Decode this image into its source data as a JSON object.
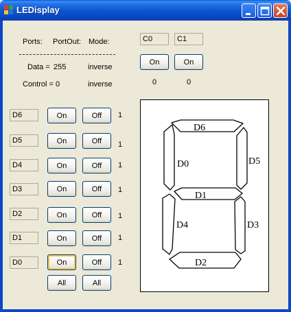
{
  "window": {
    "title": "LEDisplay",
    "icon": "app-icon",
    "controls": [
      "minimize-icon",
      "maximize-icon",
      "close-icon"
    ]
  },
  "header": {
    "ports_label": "Ports:",
    "portout_label": "PortOut:",
    "mode_label": "Mode:",
    "data_label": "Data =",
    "data_value": "255",
    "data_mode": "inverse",
    "control_label": "Control = 0",
    "control_mode": "inverse"
  },
  "control_bits": [
    {
      "name": "C0",
      "button": "On",
      "value": "0"
    },
    {
      "name": "C1",
      "button": "On",
      "value": "0"
    }
  ],
  "data_bits": [
    {
      "name": "D6",
      "on": "On",
      "off": "Off",
      "value": "1"
    },
    {
      "name": "D5",
      "on": "On",
      "off": "Off",
      "value": "1"
    },
    {
      "name": "D4",
      "on": "On",
      "off": "Off",
      "value": "1"
    },
    {
      "name": "D3",
      "on": "On",
      "off": "Off",
      "value": "1"
    },
    {
      "name": "D2",
      "on": "On",
      "off": "Off",
      "value": "1"
    },
    {
      "name": "D1",
      "on": "On",
      "off": "Off",
      "value": "1"
    },
    {
      "name": "D0",
      "on": "On",
      "off": "Off",
      "value": "1"
    }
  ],
  "all_buttons": {
    "on": "All",
    "off": "All"
  },
  "segments": {
    "top": "D6",
    "upper_left": "D0",
    "upper_right": "D5",
    "middle": "D1",
    "lower_left": "D4",
    "lower_right": "D3",
    "bottom": "D2"
  }
}
